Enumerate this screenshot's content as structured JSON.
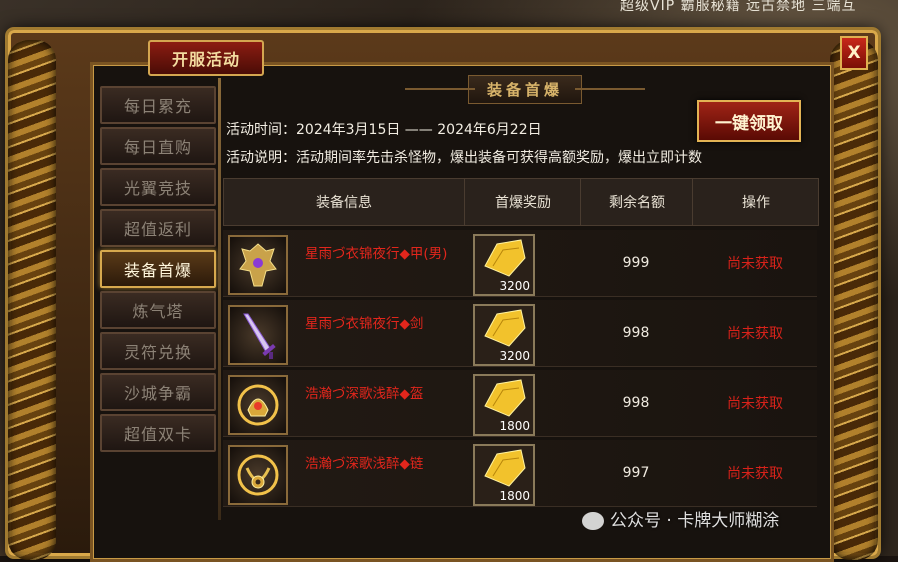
{
  "topbar": {
    "text": "超级VIP  霸服秘籍 远古禁地 三端互"
  },
  "window": {
    "title": "开服活动",
    "close_label": "X"
  },
  "sidebar": {
    "items": [
      {
        "label": "每日累充",
        "active": false
      },
      {
        "label": "每日直购",
        "active": false
      },
      {
        "label": "光翼竞技",
        "active": false
      },
      {
        "label": "超值返利",
        "active": false
      },
      {
        "label": "装备首爆",
        "active": true
      },
      {
        "label": "炼气塔",
        "active": false
      },
      {
        "label": "灵符兑换",
        "active": false
      },
      {
        "label": "沙城争霸",
        "active": false
      },
      {
        "label": "超值双卡",
        "active": false
      }
    ]
  },
  "header": {
    "title": "装备首爆"
  },
  "info": {
    "time": "活动时间：2024年3月15日 —— 2024年6月22日",
    "desc": "活动说明：活动期间率先击杀怪物，爆出装备可获得高额奖励，爆出立即计数"
  },
  "claim_button": {
    "label": "一键领取"
  },
  "table": {
    "columns": [
      "装备信息",
      "首爆奖励",
      "剩余名额",
      "操作"
    ],
    "rows": [
      {
        "item_icon": "armor-icon",
        "item_name": "星雨づ衣锦夜行◆甲(男)",
        "reward_icon": "gold-ingot-icon",
        "reward_qty": "3200",
        "remaining": "999",
        "status": "尚未获取"
      },
      {
        "item_icon": "sword-icon",
        "item_name": "星雨づ衣锦夜行◆剑",
        "reward_icon": "gold-ingot-icon",
        "reward_qty": "3200",
        "remaining": "998",
        "status": "尚未获取"
      },
      {
        "item_icon": "helmet-icon",
        "item_name": "浩瀚づ深歌浅醉◆盔",
        "reward_icon": "gold-ingot-icon",
        "reward_qty": "1800",
        "remaining": "998",
        "status": "尚未获取"
      },
      {
        "item_icon": "necklace-icon",
        "item_name": "浩瀚づ深歌浅醉◆链",
        "reward_icon": "gold-ingot-icon",
        "reward_qty": "1800",
        "remaining": "997",
        "status": "尚未获取"
      }
    ]
  },
  "watermark": {
    "text": "公众号 · 卡牌大师糊涂"
  },
  "colors": {
    "item_name": "#e2261c",
    "status": "#d8221a",
    "frame_gold": "#d9a84a"
  }
}
